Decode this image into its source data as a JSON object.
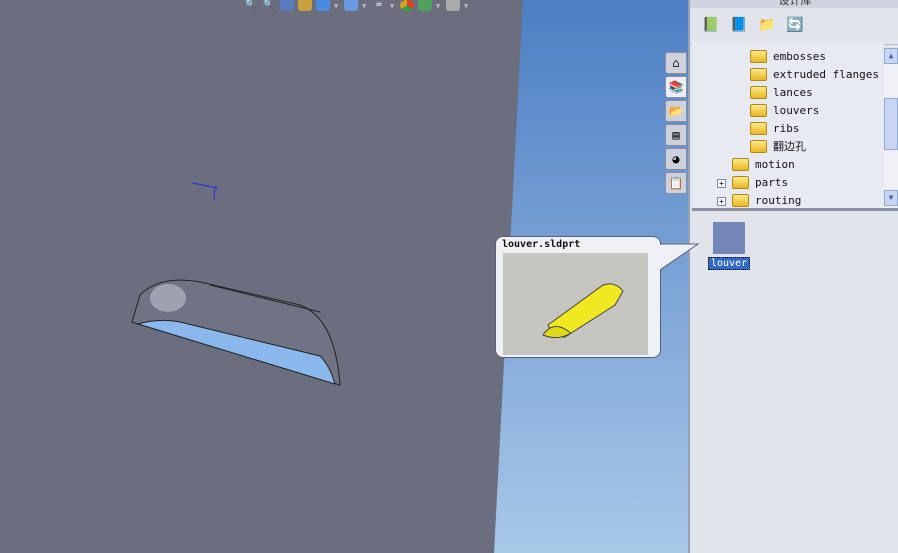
{
  "toolbar": {
    "icons": [
      "zoom-to-fit-icon",
      "zoom-area-icon",
      "zoom-in-out-icon",
      "section-view-icon",
      "view-orientation-icon",
      "display-style-icon",
      "hide-show-icon",
      "appearance-icon",
      "scene-icon",
      "view-settings-icon"
    ]
  },
  "panel": {
    "title": "设计库",
    "toolbar_icons": [
      "add-to-library-icon",
      "add-file-location-icon",
      "new-folder-icon",
      "refresh-icon"
    ],
    "tree": [
      {
        "label": "embosses"
      },
      {
        "label": "extruded flanges"
      },
      {
        "label": "lances"
      },
      {
        "label": "louvers"
      },
      {
        "label": "ribs"
      },
      {
        "label": "翻边孔"
      },
      {
        "label": "motion"
      },
      {
        "label": "parts"
      },
      {
        "label": "routing"
      }
    ],
    "files": [
      {
        "label": "louver"
      }
    ]
  },
  "tabs": [
    "home-icon",
    "design-library-icon",
    "file-explorer-icon",
    "view-palette-icon",
    "appearances-icon",
    "custom-properties-icon"
  ],
  "tooltip": {
    "title": "louver.sldprt"
  },
  "colors": {
    "viewport": "#6b6e7e",
    "sky": "#7fa8d8",
    "selection": "#316ac5"
  }
}
